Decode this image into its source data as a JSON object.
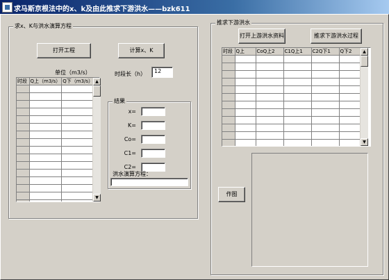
{
  "window": {
    "title": "求马斯京根法中的x、k及由此推求下游洪水——bzk611"
  },
  "left_group": {
    "title": "求x、K与洪水演算方程",
    "open_project_button": "打开工程",
    "compute_button": "计算x、K",
    "unit_label": "单位（m3/s）",
    "period_label": "时段长（h）",
    "period_value": "12",
    "grid": {
      "columns": [
        "时段",
        "Q上（m3/s）",
        "Q下（m3/s）"
      ],
      "row_count": 16
    },
    "results": {
      "title": "结果",
      "fields": [
        {
          "label": "x=",
          "value": ""
        },
        {
          "label": "K=",
          "value": ""
        },
        {
          "label": "Co=",
          "value": ""
        },
        {
          "label": "C1=",
          "value": ""
        },
        {
          "label": "C2=",
          "value": ""
        }
      ],
      "equation_label": "洪水演算方程：",
      "equation_value": ""
    }
  },
  "right_group": {
    "title": "推求下游洪水",
    "open_upstream_button": "打开上游洪水资料",
    "compute_downstream_button": "推求下游洪水过程",
    "plot_button": "作图",
    "grid": {
      "columns": [
        "时段",
        "Q上",
        "CoQ上2",
        "C1Q上1",
        "C2Q下1",
        "Q下2"
      ],
      "row_count": 12
    }
  }
}
